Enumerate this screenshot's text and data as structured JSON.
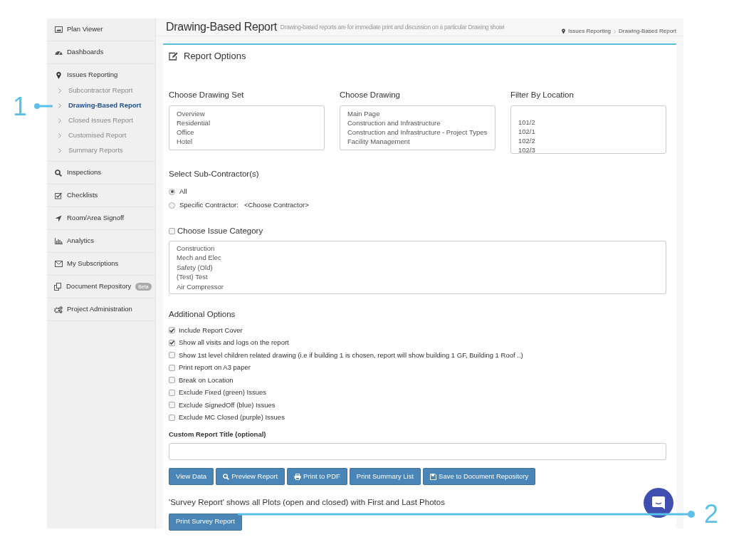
{
  "sidebar": {
    "items": [
      {
        "label": "Plan Viewer"
      },
      {
        "label": "Dashboards"
      },
      {
        "label": "Issues Reporting",
        "children": [
          {
            "label": "Subcontractor Report",
            "selected": false
          },
          {
            "label": "Drawing-Based Report",
            "selected": true
          },
          {
            "label": "Closed Issues Report",
            "selected": false
          },
          {
            "label": "Customised Report",
            "selected": false
          },
          {
            "label": "Summary Reports",
            "selected": false
          }
        ]
      },
      {
        "label": "Inspections"
      },
      {
        "label": "Checklists"
      },
      {
        "label": "Room/Area Signoff"
      },
      {
        "label": "Analytics"
      },
      {
        "label": "My Subscriptions"
      },
      {
        "label": "Document Repository",
        "badge": "Beta"
      },
      {
        "label": "Project Administration"
      }
    ]
  },
  "header": {
    "title": "Drawing-Based Report",
    "subtitle": "Drawing-based reports are for immediate print and discussion on a particular Drawing showi",
    "breadcrumb": [
      "Issues Reporting",
      "Drawing-Based Report"
    ]
  },
  "panel": {
    "title": "Report Options",
    "lists": [
      {
        "label": "Choose Drawing Set",
        "items": [
          "Overview",
          "Residential",
          "Office",
          "Hotel"
        ]
      },
      {
        "label": "Choose Drawing",
        "items": [
          "Main Page",
          "Construction and Infrastructure",
          "Construction and Infrastructure - Project Types",
          "Facility Management"
        ]
      },
      {
        "label": "Filter By Location",
        "items": [
          "101/2",
          "102/1",
          "102/2",
          "102/3"
        ]
      }
    ],
    "subcontractor": {
      "label": "Select Sub-Contractor(s)",
      "options": [
        {
          "label": "All",
          "selected": true
        },
        {
          "label": "Specific Contractor:",
          "selected": false,
          "value": "<Choose Contractor>"
        }
      ]
    },
    "issue_category": {
      "label": "Choose Issue Category",
      "checked": false,
      "items": [
        "Construction",
        "Mech and Elec",
        "Safety (Old)",
        "(Test) Test",
        "Air Compressor"
      ]
    },
    "additional_options": {
      "label": "Additional Options",
      "options": [
        {
          "label": "Include Report Cover",
          "checked": true
        },
        {
          "label": "Show all visits and logs on the report",
          "checked": true
        },
        {
          "label": "Show 1st level children related drawing (i.e if building 1 is chosen, report will show building 1 GF, Building 1 Roof ..)",
          "checked": false
        },
        {
          "label": "Print report on A3 paper",
          "checked": false
        },
        {
          "label": "Break on Location",
          "checked": false
        },
        {
          "label": "Exclude Fixed (green) Issues",
          "checked": false
        },
        {
          "label": "Exclude SignedOff (blue) Issues",
          "checked": false
        },
        {
          "label": "Exclude MC Closed (purple) Issues",
          "checked": false
        }
      ]
    },
    "custom_title": {
      "label": "Custom Report Title (optional)"
    },
    "buttons": [
      {
        "label": "View Data",
        "kind": "plain"
      },
      {
        "label": "Preview Report",
        "kind": "search"
      },
      {
        "label": "Print to PDF",
        "kind": "print"
      },
      {
        "label": "Print Summary List",
        "kind": "plain"
      },
      {
        "label": "Save to Document Repository",
        "kind": "save"
      }
    ],
    "survey": {
      "text": "'Survey Report' shows all Plots (open and closed) with First and Last Photos",
      "button": "Print Survey Report"
    }
  },
  "annotations": [
    "1",
    "2"
  ]
}
